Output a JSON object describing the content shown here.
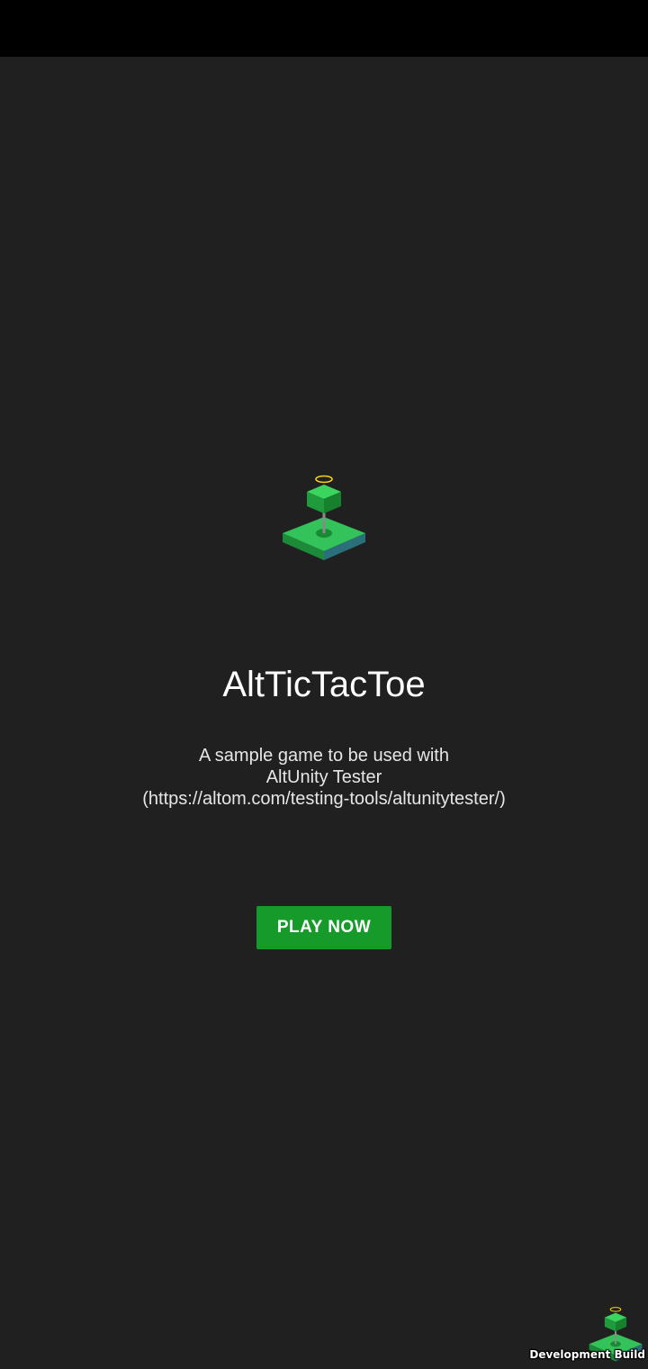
{
  "app": {
    "title": "AltTicTacToe",
    "subtitle_lines": [
      "A sample game to be used with",
      "AltUnity Tester",
      "(https://altom.com/testing-tools/altunitytester/)"
    ],
    "play_button_label": "PLAY NOW",
    "build_label": "Development Build"
  },
  "icons": {
    "logo": "game-piece-icon",
    "dev_logo": "game-piece-icon"
  },
  "colors": {
    "background": "#202020",
    "status_bar": "#000000",
    "accent_green": "#169a2a",
    "text": "#ffffff"
  }
}
